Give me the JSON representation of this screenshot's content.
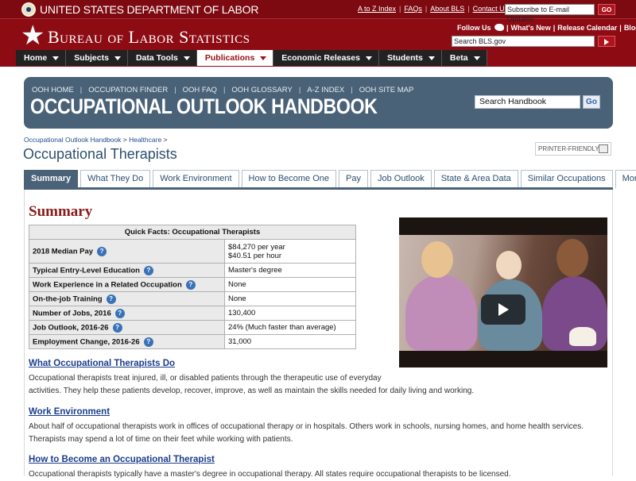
{
  "header": {
    "dol_name": "UNITED STATES DEPARTMENT OF LABOR",
    "util_links": [
      "A to Z Index",
      "FAQs",
      "About BLS",
      "Contact Us"
    ],
    "email_placeholder": "Subscribe to E-mail Updates",
    "go_label": "GO",
    "bls_name": "Bureau of Labor Statistics",
    "follow_us": "Follow Us",
    "social_links": [
      "What's New",
      "Release Calendar",
      "Blog"
    ],
    "search_placeholder": "Search BLS.gov",
    "colors": {
      "header_red": "#8d0c14",
      "nav_dark": "#222222"
    }
  },
  "nav": {
    "items": [
      {
        "label": "Home"
      },
      {
        "label": "Subjects"
      },
      {
        "label": "Data Tools"
      },
      {
        "label": "Publications",
        "active": true
      },
      {
        "label": "Economic Releases"
      },
      {
        "label": "Students"
      },
      {
        "label": "Beta"
      }
    ]
  },
  "ooh": {
    "links": [
      "OOH HOME",
      "OCCUPATION FINDER",
      "OOH FAQ",
      "OOH GLOSSARY",
      "A-Z INDEX",
      "OOH SITE MAP"
    ],
    "title": "OCCUPATIONAL OUTLOOK HANDBOOK",
    "search_placeholder": "Search Handbook",
    "go_label": "Go",
    "colors": {
      "banner": "#4a6277"
    }
  },
  "page": {
    "breadcrumb": [
      "Occupational Outlook Handbook",
      "Healthcare"
    ],
    "title": "Occupational Therapists",
    "printer_friendly": "PRINTER-FRIENDLY"
  },
  "tabs": [
    {
      "label": "Summary",
      "active": true
    },
    {
      "label": "What They Do"
    },
    {
      "label": "Work Environment"
    },
    {
      "label": "How to Become One"
    },
    {
      "label": "Pay"
    },
    {
      "label": "Job Outlook"
    },
    {
      "label": "State & Area Data"
    },
    {
      "label": "Similar Occupations"
    },
    {
      "label": "More Info"
    }
  ],
  "summary": {
    "heading": "Summary",
    "quick_facts": {
      "caption": "Quick Facts: Occupational Therapists",
      "rows": [
        {
          "label": "2018 Median Pay",
          "values": [
            "$84,270 per year",
            "$40.51 per hour"
          ]
        },
        {
          "label": "Typical Entry-Level Education",
          "values": [
            "Master's degree"
          ]
        },
        {
          "label": "Work Experience in a Related Occupation",
          "values": [
            "None"
          ]
        },
        {
          "label": "On-the-job Training",
          "values": [
            "None"
          ]
        },
        {
          "label": "Number of Jobs, 2016",
          "values": [
            "130,400"
          ]
        },
        {
          "label": "Job Outlook, 2016-26",
          "values": [
            "24% (Much faster than average)"
          ]
        },
        {
          "label": "Employment Change, 2016-26",
          "values": [
            "31,000"
          ]
        }
      ]
    },
    "sections": [
      {
        "link": "What Occupational Therapists Do",
        "text": [
          "Occupational therapists treat injured, ill, or disabled patients through the therapeutic use of everyday",
          "activities. They help these patients develop, recover, improve, as well as maintain the skills needed for daily living and working."
        ]
      },
      {
        "link": "Work Environment",
        "text": [
          "About half of occupational therapists work in offices of occupational therapy or in hospitals. Others work in schools, nursing homes, and home health services.",
          "Therapists may spend a lot of time on their feet while working with patients."
        ]
      },
      {
        "link": "How to Become an Occupational Therapist",
        "text": [
          "Occupational therapists typically have a master's degree in occupational therapy. All states require occupational therapists to be licensed."
        ]
      }
    ]
  }
}
